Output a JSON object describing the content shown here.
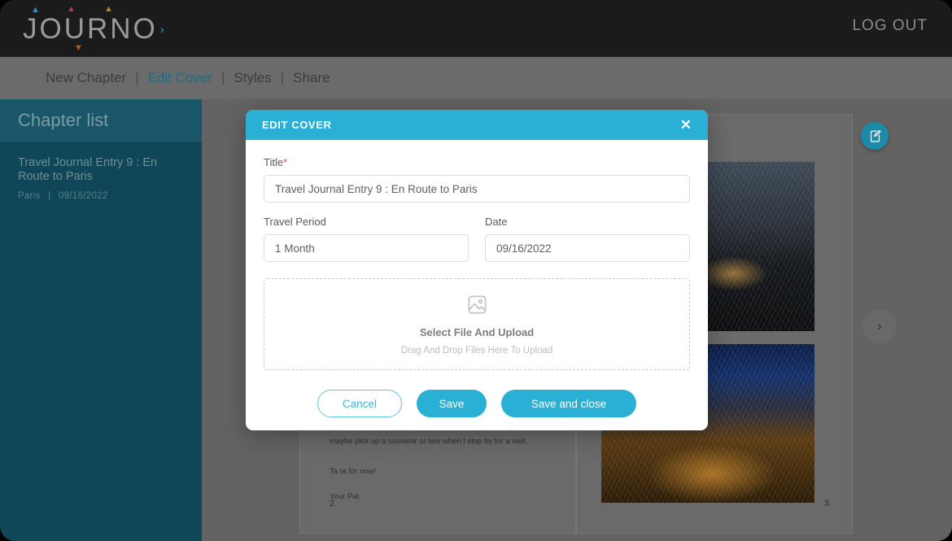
{
  "brand": {
    "logo_text": "JOURNO",
    "logo_caret": "›",
    "arrow_up": "▲",
    "arrow_down": "▼",
    "arrow_colors": [
      "#2f93b8",
      "#a8386d",
      "#b5842b",
      "#a8612b"
    ]
  },
  "topbar": {
    "logout_label": "LOG OUT"
  },
  "nav": {
    "separator": "|",
    "items": [
      {
        "label": "New Chapter",
        "active": false
      },
      {
        "label": "Edit Cover",
        "active": true
      },
      {
        "label": "Styles",
        "active": false
      },
      {
        "label": "Share",
        "active": false
      }
    ]
  },
  "sidebar": {
    "header": "Chapter list",
    "chapters": [
      {
        "title": "Travel Journal Entry 9 : En Route to Paris",
        "location": "Paris",
        "meta_separator": "|",
        "date": "09/16/2022"
      }
    ]
  },
  "workspace": {
    "doc_fab_icon": "document-edit-icon",
    "next_arrow": "›",
    "pencil_icon": "✎",
    "left_page": {
      "lines": [
        "maybe pick up a souvenir or two when I stop by for a visit.",
        "Ta ta for now!",
        "Your Pal,"
      ],
      "page_number": "2"
    },
    "right_page": {
      "page_number": "3",
      "photos": [
        {
          "name": "canal-night-photo"
        },
        {
          "name": "city-skyline-night-photo"
        }
      ]
    }
  },
  "modal": {
    "title": "EDIT COVER",
    "close_label": "✕",
    "fields": {
      "title": {
        "label": "Title",
        "required_mark": "*",
        "value": "Travel Journal Entry 9 : En Route to Paris"
      },
      "travel_period": {
        "label": "Travel Period",
        "value": "1 Month"
      },
      "date": {
        "label": "Date",
        "value": "09/16/2022"
      }
    },
    "dropzone": {
      "icon": "image-placeholder-icon",
      "title": "Select File And Upload",
      "subtitle": "Drag And Drop Files Here To Upload"
    },
    "buttons": {
      "cancel": "Cancel",
      "save": "Save",
      "save_and_close": "Save and close"
    }
  },
  "colors": {
    "accent": "#29b0d4",
    "sidebar": "#0f4758",
    "sidebar_header": "#19566a",
    "nav_active": "#1b6e86",
    "required": "#e0464a"
  }
}
